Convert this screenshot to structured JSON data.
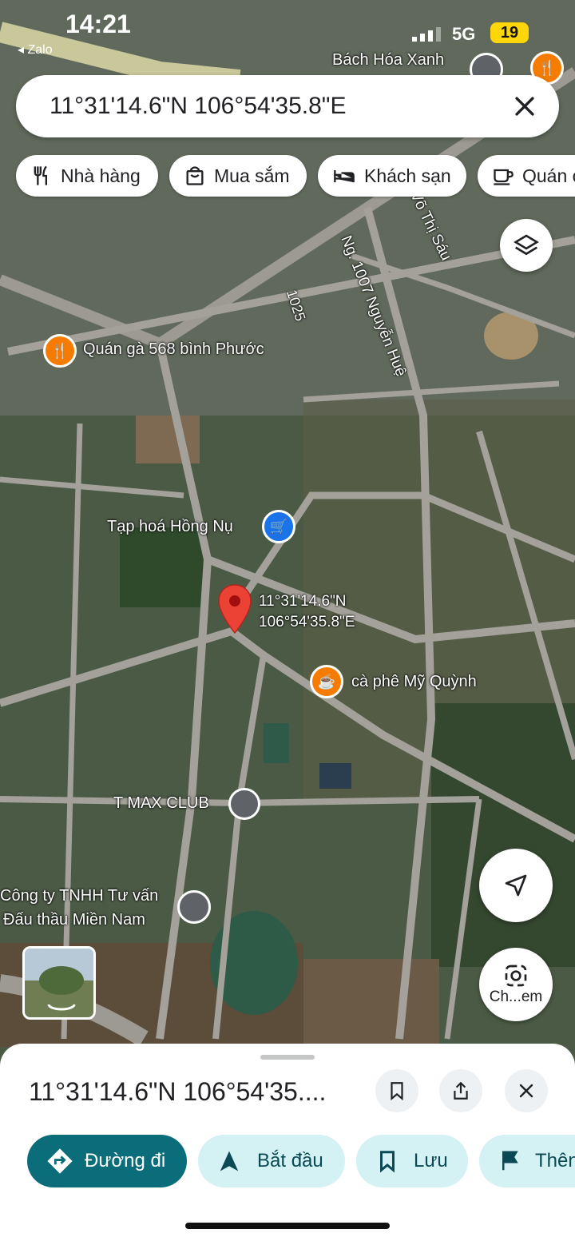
{
  "status_bar": {
    "time": "14:21",
    "back_app": "◂ Zalo",
    "network": "5G",
    "battery": "19"
  },
  "search": {
    "query": "11°31'14.6\"N 106°54'35.8\"E"
  },
  "categories": [
    {
      "label": "Nhà hàng",
      "icon": "restaurant-icon"
    },
    {
      "label": "Mua sắm",
      "icon": "shopping-bag-icon"
    },
    {
      "label": "Khách sạn",
      "icon": "hotel-bed-icon"
    },
    {
      "label": "Quán c",
      "icon": "coffee-cup-icon"
    }
  ],
  "map": {
    "places": {
      "bach_hoa": "Bách Hóa Xanh",
      "quan_ga": "Quán gà 568 bình Phước",
      "tap_hoa": "Tạp hoá Hồng Nụ",
      "ca_phe": "cà phê Mỹ Quỳnh",
      "tmax": "T MAX CLUB",
      "cong_ty_1": "Công ty TNHH Tư vấn",
      "cong_ty_2": "Đấu thầu Miền Nam"
    },
    "roads": {
      "nguyen_hue": "Ng. 1007 Nguyễn Huệ",
      "r1025": "1025",
      "vo_thi_sau": "Võ Thị Sáu"
    },
    "pin_label_1": "11°31'14.6\"N",
    "pin_label_2": "106°54'35.8\"E",
    "camera_label": "Ch...em",
    "colors": {
      "pin": "#ea4335",
      "food_pin": "#f57c00",
      "shop_pin": "#1a73e8",
      "generic_pin": "#5f6368"
    }
  },
  "sheet": {
    "title": "11°31'14.6\"N 106°54'35....",
    "actions": [
      {
        "label": "Đường đi",
        "icon": "directions-icon"
      },
      {
        "label": "Bắt đầu",
        "icon": "navigation-arrow-icon"
      },
      {
        "label": "Lưu",
        "icon": "bookmark-icon"
      },
      {
        "label": "Thên",
        "icon": "flag-icon"
      }
    ],
    "colors": {
      "primary": "#0b6d79",
      "secondary_bg": "#d4f1f4",
      "secondary_fg": "#0b4a54"
    }
  }
}
